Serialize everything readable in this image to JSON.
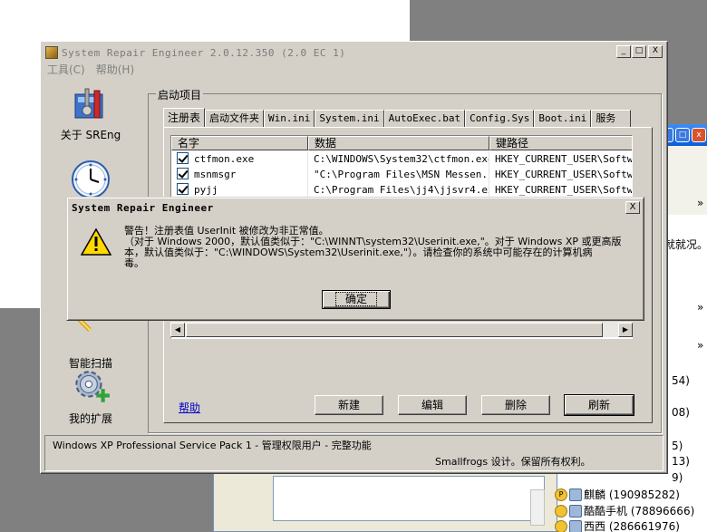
{
  "main_window": {
    "title": "System Repair Engineer 2.0.12.350 (2.0 EC 1)",
    "menu": [
      "工具(C)",
      "帮助(H)"
    ],
    "caption_buttons": {
      "minimize": "_",
      "maximize": "□",
      "close": "X"
    }
  },
  "sidebar": {
    "items": [
      {
        "label": "关于 SREng",
        "icon": "toolbox-icon"
      },
      {
        "label": "",
        "icon": "clock-icon"
      },
      {
        "label": "智能扫描",
        "icon": "scan-icon"
      },
      {
        "label": "我的扩展",
        "icon": "gear-plus-icon"
      }
    ]
  },
  "group": {
    "label": "启动项目"
  },
  "tabs": [
    "注册表",
    "启动文件夹",
    "Win.ini",
    "System.ini",
    "AutoExec.bat",
    "Config.Sys",
    "Boot.ini",
    "服务"
  ],
  "active_tab": "注册表",
  "list": {
    "columns": [
      "名字",
      "数据",
      "键路径"
    ],
    "rows": [
      {
        "name": "ctfmon.exe",
        "data": "C:\\WINDOWS\\System32\\ctfmon.exe",
        "path": "HKEY_CURRENT_USER\\Softwar",
        "checked": true
      },
      {
        "name": "msnmsgr",
        "data": "\"C:\\Program Files\\MSN Messen...",
        "path": "HKEY_CURRENT_USER\\Softwar",
        "checked": true
      },
      {
        "name": "pyjj",
        "data": "C:\\Program Files\\jj4\\jjsvr4.exe",
        "path": "HKEY_CURRENT_USER\\Softwar",
        "checked": true
      }
    ]
  },
  "actions": {
    "help": "帮助",
    "new": "新建",
    "edit": "编辑",
    "delete": "删除",
    "refresh": "刷新"
  },
  "status": {
    "line1": "Windows XP Professional Service Pack 1 - 管理权限用户 - 完整功能",
    "line2": "Smallfrogs 设计。保留所有权利。"
  },
  "dialog": {
    "title": "System Repair Engineer",
    "close": "X",
    "message_lines": [
      "警告！注册表值 UserInit 被修改为非正常值。",
      "（对于 Windows 2000，默认值类似于：\"C:\\WINNT\\system32\\Userinit.exe,\"。对于 Windows XP 或更高版",
      "本，默认值类似于：\"C:\\WINDOWS\\System32\\Userinit.exe,\"）。请检查你的系统中可能存在的计算机病",
      "毒。"
    ],
    "ok": "确定"
  },
  "background_window": {
    "fragments": [
      "»",
      "就就况。",
      "»",
      "»",
      "54)",
      "08)",
      "5)",
      "13)",
      "9)"
    ],
    "buddies": [
      {
        "name": "麒麟 (190985282)"
      },
      {
        "name": "酷酷手机 (78896666)"
      },
      {
        "name": "西西 (286661976)"
      }
    ]
  }
}
